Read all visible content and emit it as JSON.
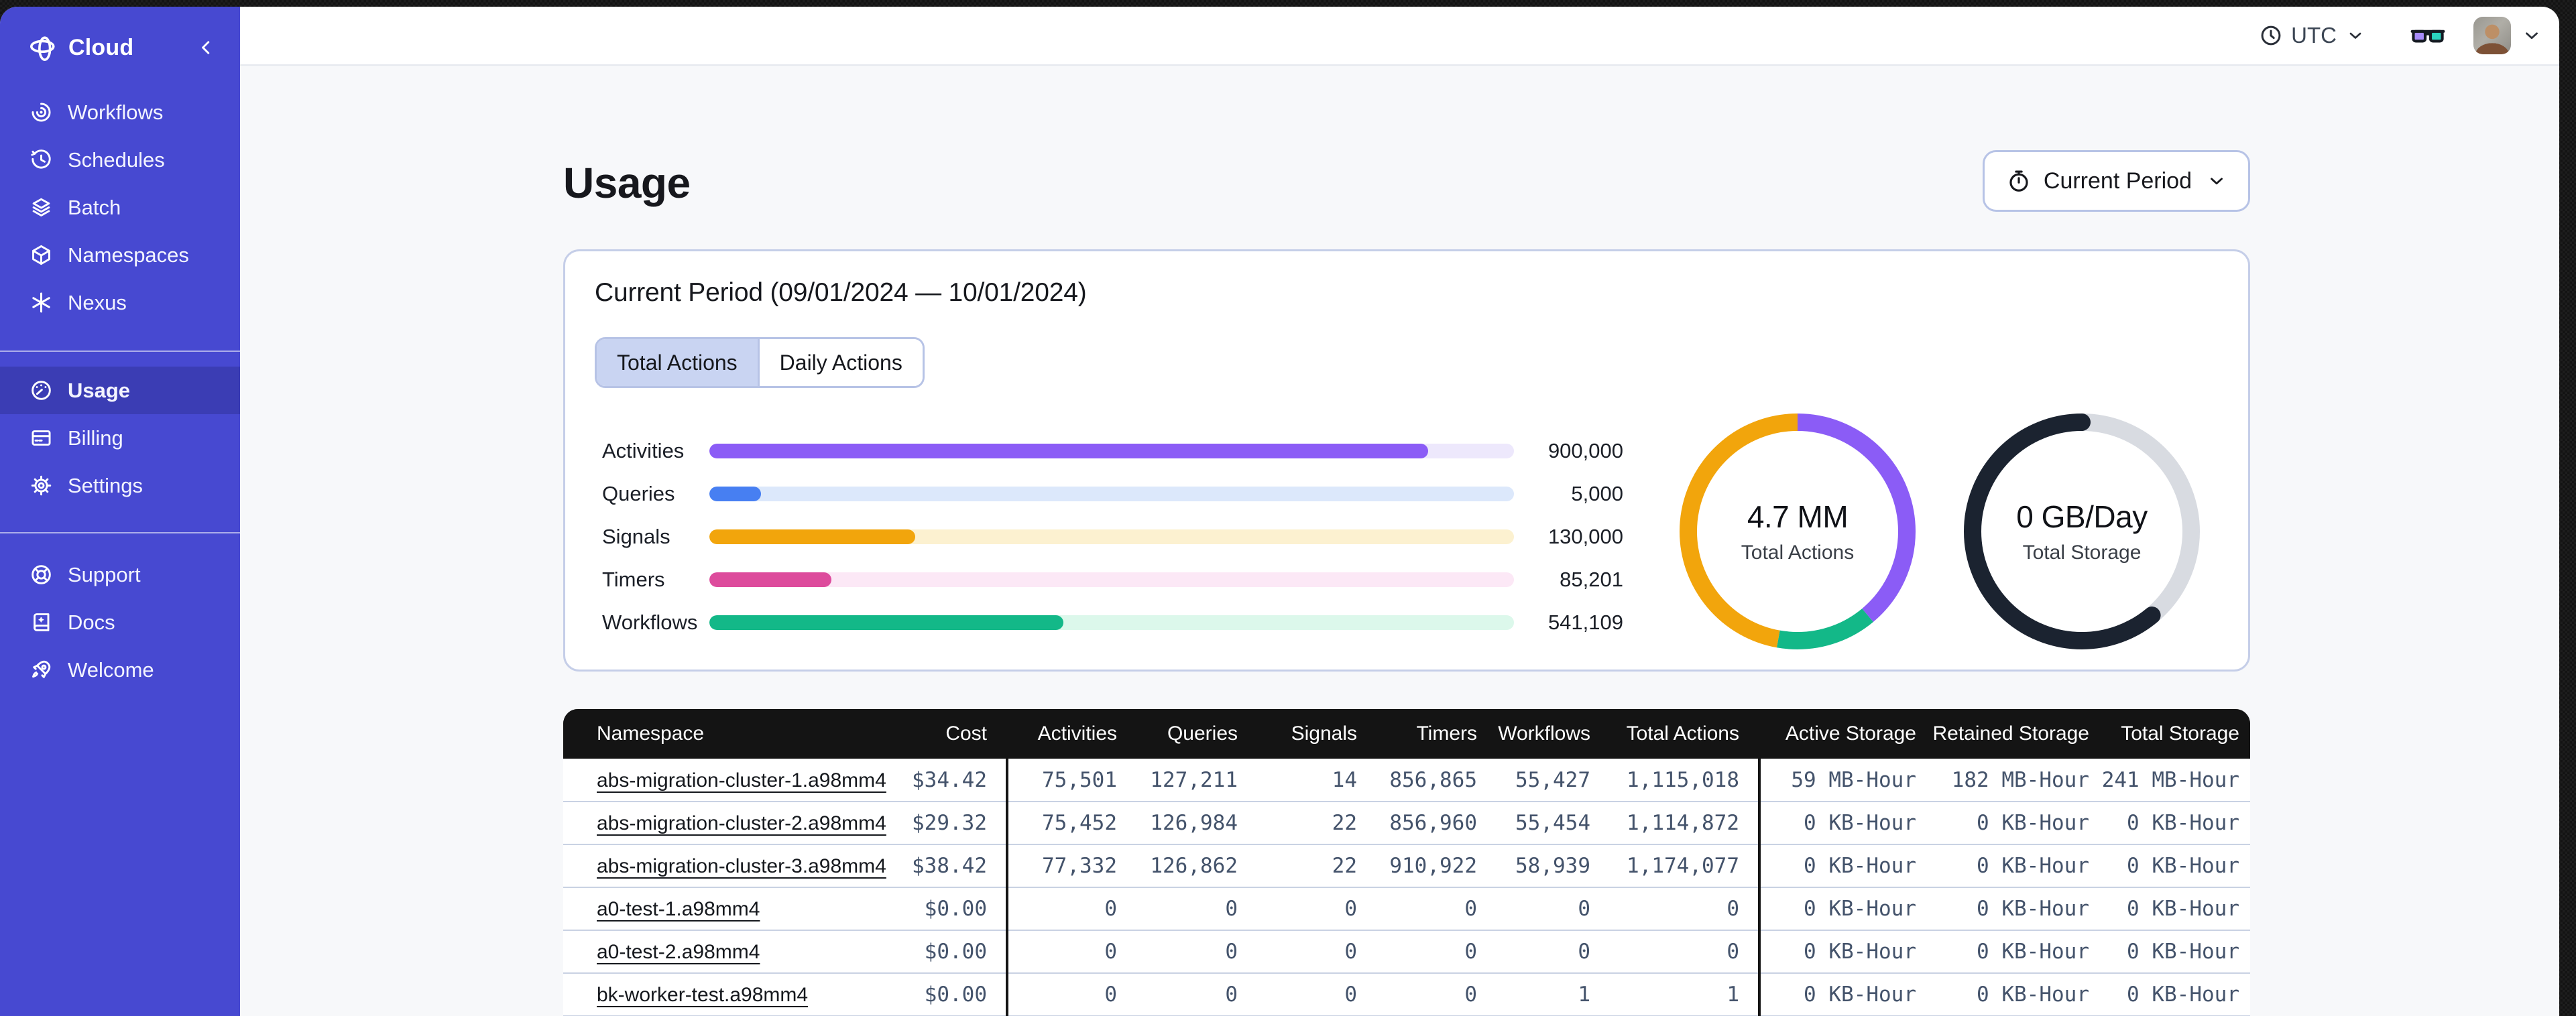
{
  "sidebar": {
    "header": {
      "label": "Cloud"
    },
    "nav_top": [
      {
        "label": "Workflows"
      },
      {
        "label": "Schedules"
      },
      {
        "label": "Batch"
      },
      {
        "label": "Namespaces"
      },
      {
        "label": "Nexus"
      }
    ],
    "nav_account": [
      {
        "label": "Usage",
        "active": true
      },
      {
        "label": "Billing",
        "active": false
      },
      {
        "label": "Settings",
        "active": false
      }
    ],
    "nav_bottom": [
      {
        "label": "Support"
      },
      {
        "label": "Docs"
      },
      {
        "label": "Welcome"
      }
    ]
  },
  "topbar": {
    "timezone": "UTC"
  },
  "page": {
    "title": "Usage",
    "period_button_label": "Current Period"
  },
  "usage_card": {
    "title": "Current Period (09/01/2024 — 10/01/2024)",
    "tabs": [
      {
        "label": "Total Actions",
        "selected": true
      },
      {
        "label": "Daily Actions",
        "selected": false
      }
    ]
  },
  "chart_data": {
    "type": "bar",
    "title": "Current Period usage",
    "bars": [
      {
        "label": "Activities",
        "value": "900,000",
        "fill_percent": 89.3,
        "fill_color": "#8B5CF6",
        "track_color": "#EDE8FC"
      },
      {
        "label": "Queries",
        "value": "5,000",
        "fill_percent": 6.4,
        "fill_color": "#477FF2",
        "track_color": "#DCE8FB"
      },
      {
        "label": "Signals",
        "value": "130,000",
        "fill_percent": 25.6,
        "fill_color": "#F2A50C",
        "track_color": "#FCF1D0"
      },
      {
        "label": "Timers",
        "value": "85,201",
        "fill_percent": 15.2,
        "fill_color": "#DD4B9C",
        "track_color": "#FCE8F6"
      },
      {
        "label": "Workflows",
        "value": "541,109",
        "fill_percent": 44.0,
        "fill_color": "#13B888",
        "track_color": "#DCF8EB"
      }
    ],
    "donuts": [
      {
        "value": "4.7 MM",
        "label": "Total Actions",
        "segments": [
          {
            "name": "activities",
            "color": "#8B5CF6",
            "percent": 38.9,
            "round_cap": false
          },
          {
            "name": "workflows",
            "color": "#13B888",
            "percent": 13.9,
            "round_cap": false
          },
          {
            "name": "signals",
            "color": "#F2A50C",
            "percent": 47.2,
            "round_cap": false
          }
        ]
      },
      {
        "value": "0 GB/Day",
        "label": "Total Storage",
        "segments": [
          {
            "name": "track",
            "color": "#D8DBE1",
            "percent": 38.9,
            "round_cap": false
          },
          {
            "name": "storage",
            "color": "#1B2330",
            "percent": 61.1,
            "round_cap": true
          }
        ]
      }
    ]
  },
  "table": {
    "columns": [
      "Namespace",
      "Cost",
      "Activities",
      "Queries",
      "Signals",
      "Timers",
      "Workflows",
      "Total Actions",
      "Active Storage",
      "Retained Storage",
      "Total Storage"
    ],
    "rows": [
      [
        "abs-migration-cluster-1.a98mm4",
        "$34.42",
        "75,501",
        "127,211",
        "14",
        "856,865",
        "55,427",
        "1,115,018",
        "59 MB-Hour",
        "182 MB-Hour",
        "241 MB-Hour"
      ],
      [
        "abs-migration-cluster-2.a98mm4",
        "$29.32",
        "75,452",
        "126,984",
        "22",
        "856,960",
        "55,454",
        "1,114,872",
        "0 KB-Hour",
        "0 KB-Hour",
        "0 KB-Hour"
      ],
      [
        "abs-migration-cluster-3.a98mm4",
        "$38.42",
        "77,332",
        "126,862",
        "22",
        "910,922",
        "58,939",
        "1,174,077",
        "0 KB-Hour",
        "0 KB-Hour",
        "0 KB-Hour"
      ],
      [
        "a0-test-1.a98mm4",
        "$0.00",
        "0",
        "0",
        "0",
        "0",
        "0",
        "0",
        "0 KB-Hour",
        "0 KB-Hour",
        "0 KB-Hour"
      ],
      [
        "a0-test-2.a98mm4",
        "$0.00",
        "0",
        "0",
        "0",
        "0",
        "0",
        "0",
        "0 KB-Hour",
        "0 KB-Hour",
        "0 KB-Hour"
      ],
      [
        "bk-worker-test.a98mm4",
        "$0.00",
        "0",
        "0",
        "0",
        "0",
        "1",
        "1",
        "0 KB-Hour",
        "0 KB-Hour",
        "0 KB-Hour"
      ]
    ]
  }
}
